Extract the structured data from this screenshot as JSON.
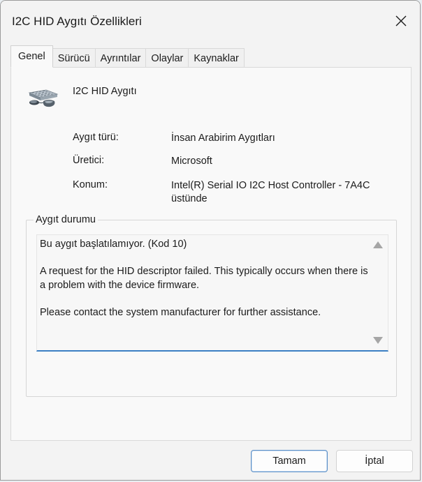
{
  "window": {
    "title": "I2C HID Aygıtı Özellikleri"
  },
  "tabs": [
    {
      "label": "Genel",
      "active": true
    },
    {
      "label": "Sürücü",
      "active": false
    },
    {
      "label": "Ayrıntılar",
      "active": false
    },
    {
      "label": "Olaylar",
      "active": false
    },
    {
      "label": "Kaynaklar",
      "active": false
    }
  ],
  "device": {
    "name": "I2C HID Aygıtı",
    "icon": "hid-device-icon",
    "properties": [
      {
        "label": "Aygıt türü:",
        "value": "İnsan Arabirim Aygıtları"
      },
      {
        "label": "Üretici:",
        "value": "Microsoft"
      },
      {
        "label": "Konum:",
        "value": "Intel(R) Serial IO I2C Host Controller - 7A4C üstünde"
      }
    ]
  },
  "status": {
    "legend": "Aygıt durumu",
    "text": "Bu aygıt başlatılamıyor. (Kod 10)\n\nA request for the HID descriptor failed. This typically occurs when there is a problem with the device firmware.\n\nPlease contact the system manufacturer for further assistance."
  },
  "buttons": {
    "ok": "Tamam",
    "cancel": "İptal"
  },
  "colors": {
    "accent": "#3b7fc4"
  }
}
